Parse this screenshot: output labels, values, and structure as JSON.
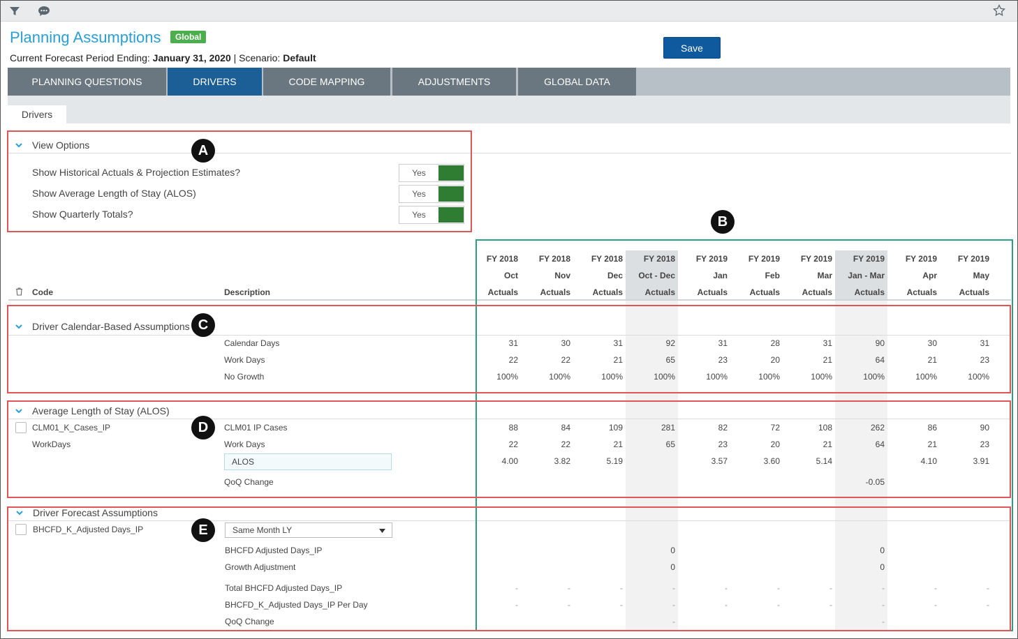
{
  "header": {
    "title": "Planning Assumptions",
    "badge": "Global",
    "period_label": "Current Forecast Period Ending: ",
    "period_value": "January 31, 2020",
    "scenario_label": " | Scenario: ",
    "scenario_value": "Default",
    "save_label": "Save"
  },
  "toolbar": {
    "icons": [
      "filter-icon",
      "comment-icon",
      "star-icon"
    ]
  },
  "tabs": [
    {
      "label": "PLANNING QUESTIONS",
      "active": false
    },
    {
      "label": "DRIVERS",
      "active": true
    },
    {
      "label": "CODE MAPPING",
      "active": false
    },
    {
      "label": "ADJUSTMENTS",
      "active": false
    },
    {
      "label": "GLOBAL DATA",
      "active": false
    }
  ],
  "subtab": "Drivers",
  "view_options": {
    "title": "View Options",
    "items": [
      {
        "label": "Show Historical Actuals & Projection Estimates?",
        "value": "Yes"
      },
      {
        "label": "Show Average Length of Stay (ALOS)",
        "value": "Yes"
      },
      {
        "label": "Show Quarterly Totals?",
        "value": "Yes"
      }
    ]
  },
  "markers": [
    "A",
    "B",
    "C",
    "D",
    "E"
  ],
  "grid": {
    "code_header": "Code",
    "description_header": "Description",
    "columns": [
      {
        "year": "FY 2018",
        "period": "Oct",
        "type": "Actuals",
        "quarter": false
      },
      {
        "year": "FY 2018",
        "period": "Nov",
        "type": "Actuals",
        "quarter": false
      },
      {
        "year": "FY 2018",
        "period": "Dec",
        "type": "Actuals",
        "quarter": false
      },
      {
        "year": "FY 2018",
        "period": "Oct - Dec",
        "type": "Actuals",
        "quarter": true
      },
      {
        "year": "FY 2019",
        "period": "Jan",
        "type": "Actuals",
        "quarter": false
      },
      {
        "year": "FY 2019",
        "period": "Feb",
        "type": "Actuals",
        "quarter": false
      },
      {
        "year": "FY 2019",
        "period": "Mar",
        "type": "Actuals",
        "quarter": false
      },
      {
        "year": "FY 2019",
        "period": "Jan - Mar",
        "type": "Actuals",
        "quarter": true
      },
      {
        "year": "FY 2019",
        "period": "Apr",
        "type": "Actuals",
        "quarter": false
      },
      {
        "year": "FY 2019",
        "period": "May",
        "type": "Actuals",
        "quarter": false
      }
    ]
  },
  "calendar_section": {
    "title": "Driver Calendar-Based Assumptions",
    "rows": [
      {
        "description": "Calendar Days",
        "values": [
          "31",
          "30",
          "31",
          "92",
          "31",
          "28",
          "31",
          "90",
          "30",
          "31"
        ]
      },
      {
        "description": "Work Days",
        "values": [
          "22",
          "22",
          "21",
          "65",
          "23",
          "20",
          "21",
          "64",
          "21",
          "23"
        ]
      },
      {
        "description": "No Growth",
        "values": [
          "100%",
          "100%",
          "100%",
          "100%",
          "100%",
          "100%",
          "100%",
          "100%",
          "100%",
          "100%"
        ]
      }
    ]
  },
  "alos_section": {
    "title": "Average Length of Stay (ALOS)",
    "code_1": "CLM01_K_Cases_IP",
    "code_2": "WorkDays",
    "rows": [
      {
        "description": "CLM01 IP Cases",
        "values": [
          "88",
          "84",
          "109",
          "281",
          "82",
          "72",
          "108",
          "262",
          "86",
          "90"
        ]
      },
      {
        "description": "Work Days",
        "values": [
          "22",
          "22",
          "21",
          "65",
          "23",
          "20",
          "21",
          "64",
          "21",
          "23"
        ]
      },
      {
        "description": "ALOS",
        "values": [
          "4.00",
          "3.82",
          "5.19",
          "",
          "3.57",
          "3.60",
          "5.14",
          "",
          "4.10",
          "3.91"
        ]
      },
      {
        "description": "QoQ Change",
        "values": [
          "",
          "",
          "",
          "",
          "",
          "",
          "",
          "-0.05",
          "",
          ""
        ]
      }
    ]
  },
  "forecast_section": {
    "title": "Driver Forecast Assumptions",
    "code": "BHCFD_K_Adjusted Days_IP",
    "dropdown_value": "Same Month LY",
    "rows": [
      {
        "description": "BHCFD Adjusted Days_IP",
        "values": [
          "",
          "",
          "",
          "0",
          "",
          "",
          "",
          "0",
          "",
          ""
        ]
      },
      {
        "description": "Growth Adjustment",
        "values": [
          "",
          "",
          "",
          "0",
          "",
          "",
          "",
          "0",
          "",
          ""
        ]
      },
      {
        "description": "Total BHCFD Adjusted Days_IP",
        "values": [
          "-",
          "-",
          "-",
          "-",
          "-",
          "-",
          "-",
          "-",
          "-",
          "-"
        ]
      },
      {
        "description": "BHCFD_K_Adjusted Days_IP Per Day",
        "values": [
          "-",
          "-",
          "-",
          "-",
          "-",
          "-",
          "-",
          "-",
          "-",
          "-"
        ]
      },
      {
        "description": "QoQ Change",
        "values": [
          "",
          "",
          "",
          "-",
          "",
          "",
          "",
          "-",
          "",
          ""
        ]
      }
    ]
  },
  "colors": {
    "accent": "#2a9fd6",
    "tab_bg": "#6a7781",
    "tab_active": "#1c5e96",
    "toggle_on": "#2e7d32",
    "highlight_red": "#e05555",
    "highlight_green": "#2a9d82"
  }
}
